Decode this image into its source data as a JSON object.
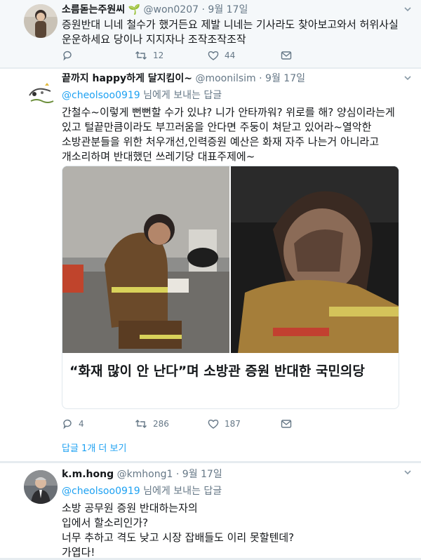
{
  "tweets": [
    {
      "name": "소름돋는주원씨",
      "emoji_label": "🌱",
      "handle": "@won0207",
      "separator": "·",
      "time": "9월 17일",
      "text": "증원반대 니네 철수가 했거든요 제발 니네는 기사라도 찾아보고와서 허위사실 운운하세요 당이나 지지자나 조작조작조작",
      "counts": {
        "reply": "",
        "retweet": "12",
        "like": "44"
      }
    },
    {
      "name": "끝까지 happy하게 달지킴이~",
      "handle": "@moonilsim",
      "separator": "·",
      "time": "9월 17일",
      "reply_mention": "@cheolsoo0919",
      "reply_suffix": " 님에게 보내는 답글",
      "text": "간철수~이렇게 뻔뻔할 수가 있냐? 니가 안타까워? 위로를 해? 양심이라는게 있고 털끝만큼이라도 부끄러움을 안다면 주둥이 쳐닫고 있어라~열악한 소방관분들을 위한 처우개선,인력증원 예산은 화재 자주 나는거 아니라고 개소리하며 반대했던 쓰레기당 대표주제에~",
      "card_title": "“화재 많이 안 난다”며 소방관 증원 반대한 국민의당",
      "counts": {
        "reply": "4",
        "retweet": "286",
        "like": "187"
      },
      "more_replies": "답글 1개 더 보기"
    },
    {
      "name": "k.m.hong",
      "handle": "@kmhong1",
      "separator": "·",
      "time": "9월 17일",
      "reply_mention": "@cheolsoo0919",
      "reply_suffix": " 님에게 보내는 답글",
      "text_lines": [
        "소방 공무원 증원 반대하는자의",
        "입에서 할소리인가?",
        "너무 추하고 격도 낮고 시장 잡배들도 이리 못할텐데?",
        "가엽다!"
      ]
    }
  ],
  "colors": {
    "accent": "#1da1f2",
    "muted": "#657786",
    "background": "#e6ecf0"
  }
}
